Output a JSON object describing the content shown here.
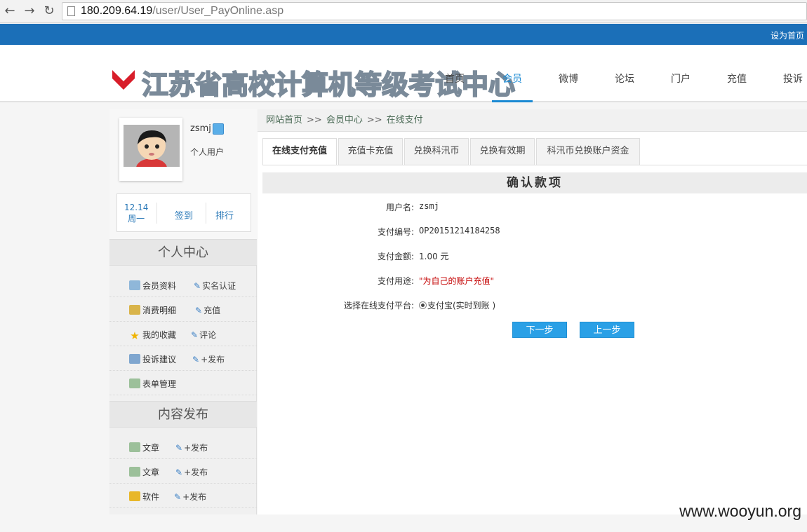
{
  "browser": {
    "back_icon": "arrow-left-icon",
    "forward_icon": "arrow-right-icon",
    "reload_icon": "reload-icon",
    "url_host": "180.209.64.19",
    "url_path": "/user/User_PayOnline.asp"
  },
  "topbar": {
    "set_home": "设为首页"
  },
  "header": {
    "logo_text": "江苏省高校计算机等级考试中心",
    "nav": [
      "首页",
      "会员",
      "微博",
      "论坛",
      "门户",
      "充值",
      "投诉"
    ],
    "active_nav": "会员",
    "accent_color": "#1b8ad3"
  },
  "profile": {
    "username": "zsmj",
    "user_type": "个人用户",
    "checkin_date": "12.14",
    "checkin_weekday": "周一",
    "checkin_label": "签到",
    "rank_label": "排行"
  },
  "sidebar": {
    "personal_center_title": "个人中心",
    "personal_items": [
      {
        "main": "会员资料",
        "sub": "实名认证",
        "icon": "id-card-icon"
      },
      {
        "main": "消费明细",
        "sub": "充值",
        "icon": "money-bag-icon"
      },
      {
        "main": "我的收藏",
        "sub": "评论",
        "icon": "star-icon"
      },
      {
        "main": "投诉建议",
        "sub": "+发布",
        "icon": "document-icon"
      },
      {
        "main": "表单管理",
        "sub": "",
        "icon": "form-icon"
      }
    ],
    "content_publish_title": "内容发布",
    "publish_items": [
      {
        "main": "文章",
        "sub": "+发布",
        "icon": "article-icon"
      },
      {
        "main": "文章",
        "sub": "+发布",
        "icon": "article-icon"
      },
      {
        "main": "软件",
        "sub": "+发布",
        "icon": "software-icon"
      }
    ]
  },
  "breadcrumb": [
    "网站首页",
    "会员中心",
    "在线支付"
  ],
  "breadcrumb_sep": ">>",
  "tabs": [
    "在线支付充值",
    "充值卡充值",
    "兑换科汛币",
    "兑换有效期",
    "科汛币兑换账户资金"
  ],
  "active_tab": "在线支付充值",
  "confirm_title": "确认款项",
  "form": {
    "username_label": "用户名:",
    "username_value": "zsmj",
    "order_label": "支付编号:",
    "order_value": "OP20151214184258",
    "amount_label": "支付金额:",
    "amount_value": "1.00 元",
    "purpose_label": "支付用途:",
    "purpose_value": "\"为自己的账户充值\"",
    "platform_label": "选择在线支付平台:",
    "platform_value": "支付宝(实时到账 )"
  },
  "buttons": {
    "next": "下一步",
    "prev": "上一步"
  },
  "watermark": "www.wooyun.org"
}
